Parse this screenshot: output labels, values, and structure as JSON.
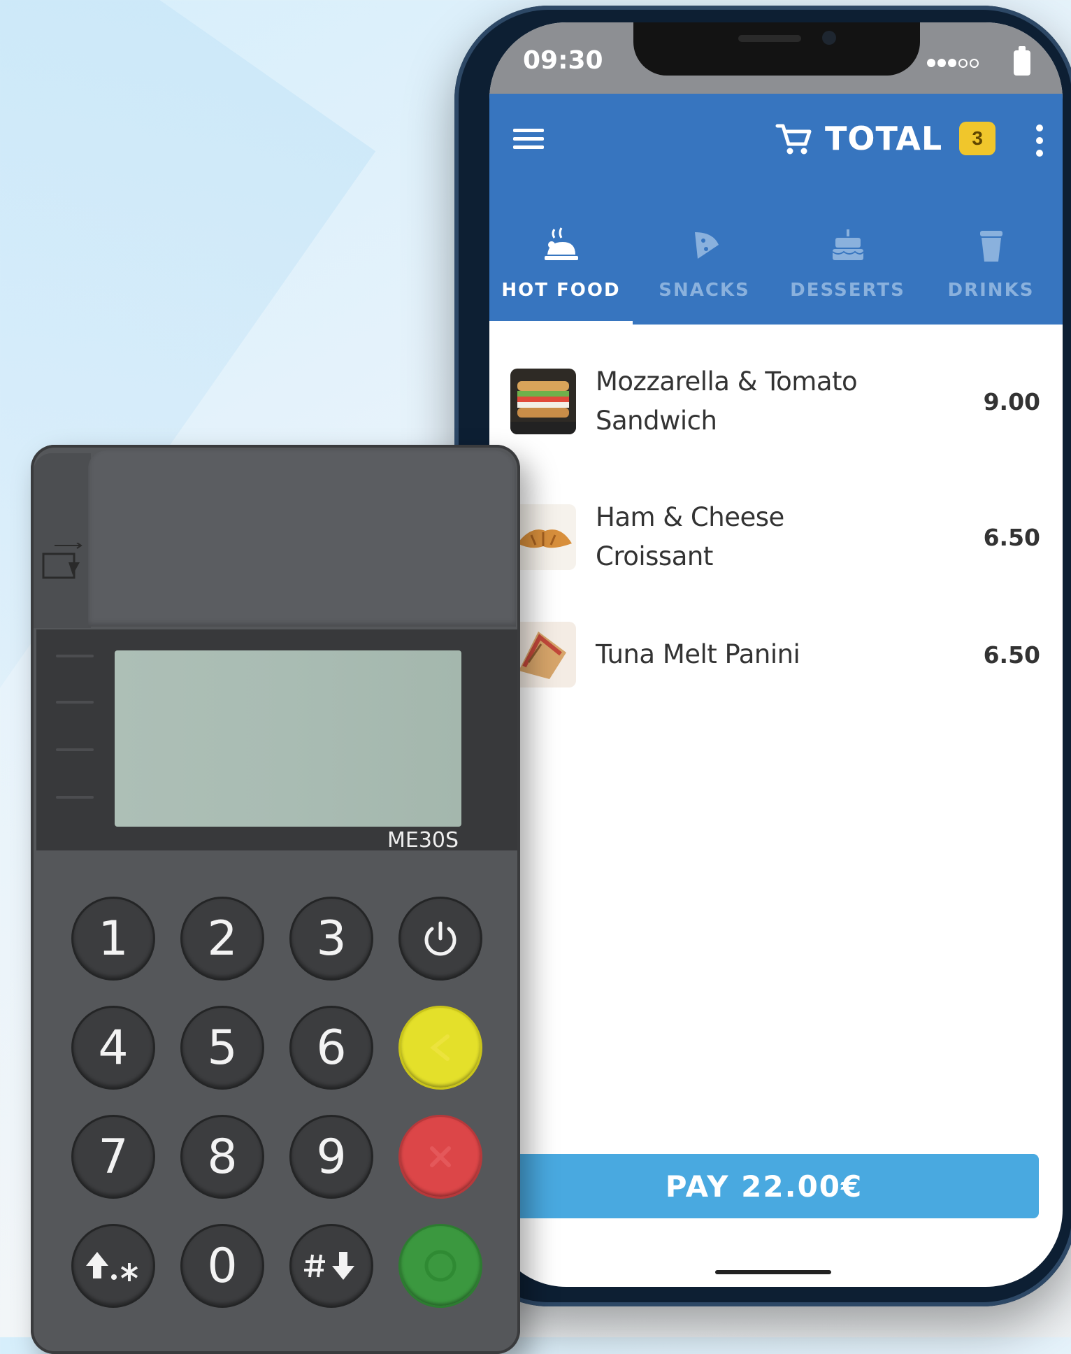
{
  "status_bar": {
    "time": "09:30"
  },
  "app_bar": {
    "total_label": "TOTAL",
    "cart_count": "3",
    "menu_icon": "hamburger-menu-icon",
    "cart_icon": "shopping-cart-icon",
    "overflow_icon": "more-vertical-icon"
  },
  "tabs": [
    {
      "label": "HOT FOOD",
      "icon": "hot-food-icon",
      "active": true
    },
    {
      "label": "SNACKS",
      "icon": "pizza-slice-icon",
      "active": false
    },
    {
      "label": "DESSERTS",
      "icon": "cake-icon",
      "active": false
    },
    {
      "label": "DRINKS",
      "icon": "cup-icon",
      "active": false
    }
  ],
  "products": [
    {
      "name": "Mozzarella & Tomato Sandwich",
      "price": "9.00"
    },
    {
      "name": "Ham & Cheese Croissant",
      "price": "6.50"
    },
    {
      "name": "Tuna Melt Panini",
      "price": "6.50"
    }
  ],
  "pay_button": {
    "label": "PAY 22.00€"
  },
  "reader": {
    "model": "ME30S",
    "keys": [
      "1",
      "2",
      "3",
      "4",
      "5",
      "6",
      "7",
      "8",
      "9",
      "0"
    ]
  },
  "colors": {
    "app_blue": "#3775bf",
    "pay_blue": "#49a9e0",
    "badge_yellow": "#f0c62c"
  }
}
